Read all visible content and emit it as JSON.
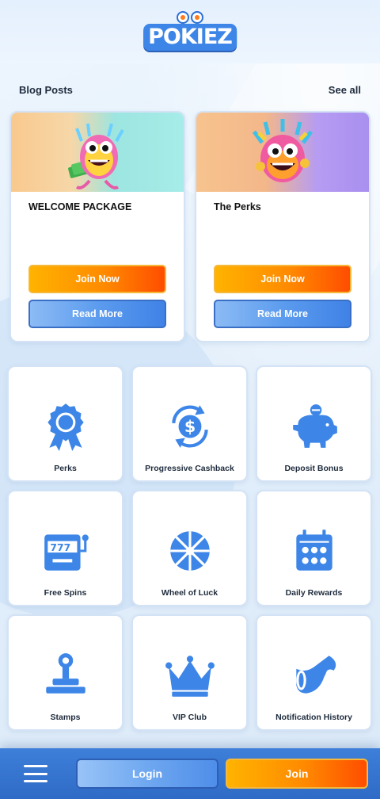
{
  "brand": {
    "name": "POKIEZ",
    "accent": "#3d86e8",
    "orange": "#ff8a00"
  },
  "blog": {
    "title": "Blog Posts",
    "see_all": "See all",
    "posts": [
      {
        "title": "WELCOME PACKAGE",
        "join_label": "Join Now",
        "read_label": "Read More"
      },
      {
        "title": "The Perks",
        "join_label": "Join Now",
        "read_label": "Read More"
      }
    ]
  },
  "features": [
    {
      "label": "Perks",
      "icon": "badge-icon"
    },
    {
      "label": "Progressive Cashback",
      "icon": "cashback-icon"
    },
    {
      "label": "Deposit Bonus",
      "icon": "piggy-bank-icon"
    },
    {
      "label": "Free Spins",
      "icon": "slot-machine-icon"
    },
    {
      "label": "Wheel of Luck",
      "icon": "wheel-icon"
    },
    {
      "label": "Daily Rewards",
      "icon": "calendar-icon"
    },
    {
      "label": "Stamps",
      "icon": "stamp-icon"
    },
    {
      "label": "VIP Club",
      "icon": "crown-icon"
    },
    {
      "label": "Notification History",
      "icon": "megaphone-icon"
    }
  ],
  "bottom_bar": {
    "login_label": "Login",
    "join_label": "Join",
    "menu_icon": "hamburger-icon"
  }
}
